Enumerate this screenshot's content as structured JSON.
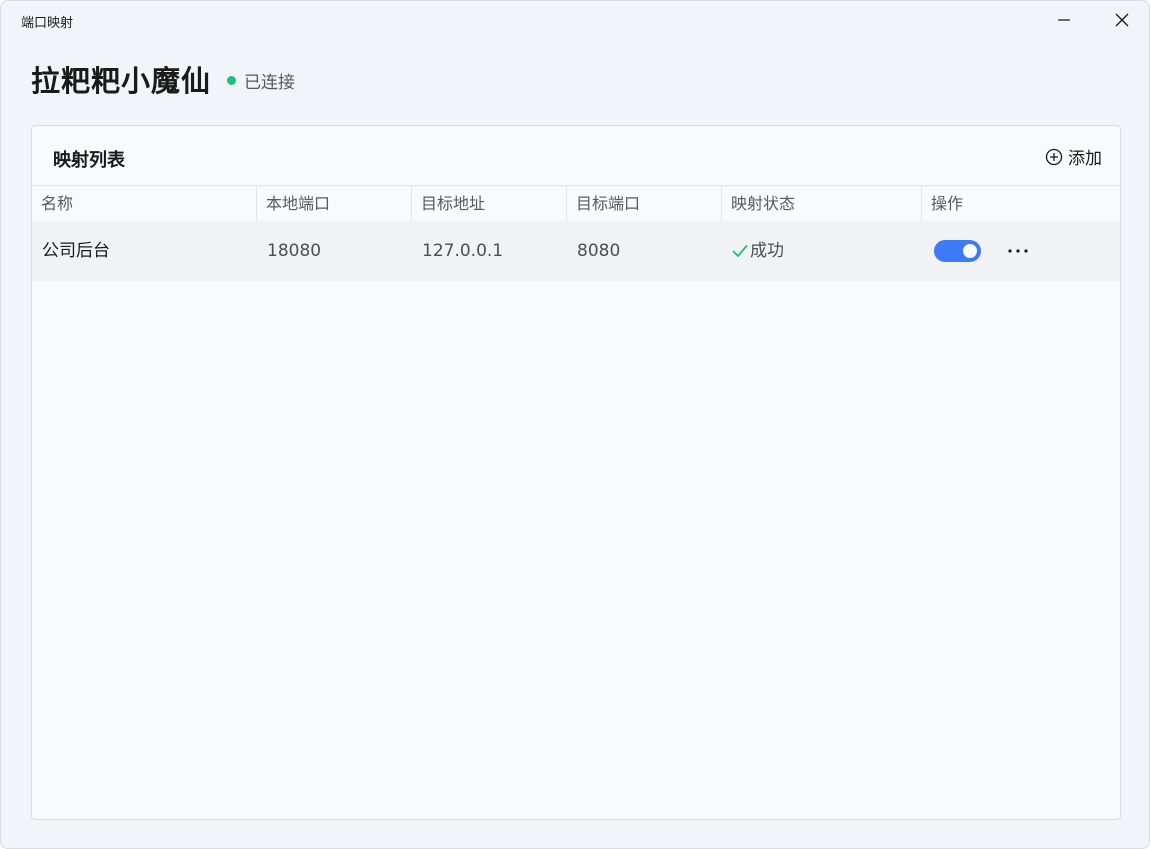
{
  "window": {
    "title": "端口映射",
    "minimize_icon": "minimize-icon",
    "close_icon": "close-icon"
  },
  "header": {
    "device_name": "拉粑粑小魔仙",
    "status_text": "已连接",
    "status_color": "#19c37d"
  },
  "card": {
    "title": "映射列表",
    "add_label": "添加",
    "add_icon": "plus-circle-icon"
  },
  "table": {
    "columns": [
      "名称",
      "本地端口",
      "目标地址",
      "目标端口",
      "映射状态",
      "操作"
    ],
    "rows": [
      {
        "name": "公司后台",
        "local_port": "18080",
        "target_address": "127.0.0.1",
        "target_port": "8080",
        "status": "成功",
        "status_icon": "check-icon",
        "enabled": true,
        "more_icon": "more-horizontal-icon"
      }
    ]
  },
  "colors": {
    "accent": "#3d7af7",
    "success": "#19c37d"
  }
}
